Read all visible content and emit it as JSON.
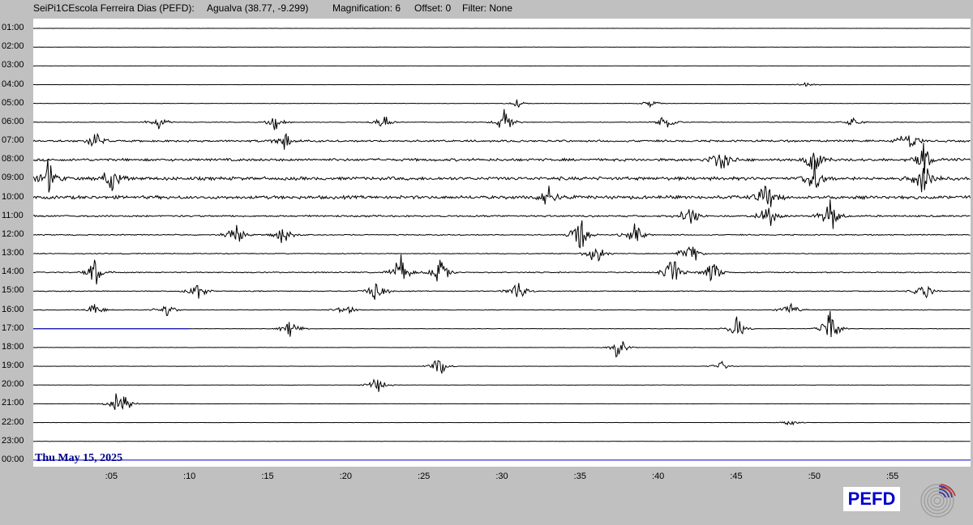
{
  "header": {
    "station": "SeiPi1CEscola Ferreira Dias (PEFD):",
    "location": "Agualva (38.77, -9.299)",
    "magnification": "Magnification: 6",
    "offset": "Offset: 0",
    "filter": "Filter: None"
  },
  "hours": [
    "01:00",
    "02:00",
    "03:00",
    "04:00",
    "05:00",
    "06:00",
    "07:00",
    "08:00",
    "09:00",
    "10:00",
    "11:00",
    "12:00",
    "13:00",
    "14:00",
    "15:00",
    "16:00",
    "17:00",
    "18:00",
    "19:00",
    "20:00",
    "21:00",
    "22:00",
    "23:00",
    "00:00"
  ],
  "minute_ticks": [
    ":05",
    ":10",
    ":15",
    ":20",
    ":25",
    ":30",
    ":35",
    ":40",
    ":45",
    ":50",
    ":55"
  ],
  "date_label": "Thu May 15, 2025",
  "logo": "PEFD",
  "colors": {
    "trace": "#000000",
    "current": "#0000cc",
    "date": "#00008b"
  },
  "current_trace": {
    "hour": "17:00",
    "minute": 10.0
  },
  "chart_data": {
    "type": "line",
    "title": "",
    "x_unit": "minutes past the hour",
    "xlim": [
      0,
      60
    ],
    "traces": [
      {
        "hour": "01:00",
        "activity": 0.05,
        "events": []
      },
      {
        "hour": "02:00",
        "activity": 0.05,
        "events": []
      },
      {
        "hour": "03:00",
        "activity": 0.05,
        "events": []
      },
      {
        "hour": "04:00",
        "activity": 0.05,
        "events": [
          {
            "minute": 49.5,
            "amp": 2
          }
        ]
      },
      {
        "hour": "05:00",
        "activity": 0.08,
        "events": [
          {
            "minute": 31,
            "amp": 2
          },
          {
            "minute": 39.5,
            "amp": 2
          }
        ]
      },
      {
        "hour": "06:00",
        "activity": 0.15,
        "events": [
          {
            "minute": 8,
            "amp": 5
          },
          {
            "minute": 15.5,
            "amp": 4
          },
          {
            "minute": 22.5,
            "amp": 5
          },
          {
            "minute": 30.2,
            "amp": 7
          },
          {
            "minute": 40.5,
            "amp": 5
          },
          {
            "minute": 52.5,
            "amp": 3
          }
        ]
      },
      {
        "hour": "07:00",
        "activity": 0.45,
        "events": [
          {
            "minute": 4,
            "amp": 5
          },
          {
            "minute": 16,
            "amp": 6
          },
          {
            "minute": 56,
            "amp": 8
          }
        ]
      },
      {
        "hour": "08:00",
        "activity": 0.6,
        "events": [
          {
            "minute": 44,
            "amp": 8
          },
          {
            "minute": 50,
            "amp": 9
          },
          {
            "minute": 57,
            "amp": 8
          }
        ]
      },
      {
        "hour": "09:00",
        "activity": 0.75,
        "events": [
          {
            "minute": 1,
            "amp": 10
          },
          {
            "minute": 5,
            "amp": 9
          },
          {
            "minute": 50,
            "amp": 10
          },
          {
            "minute": 57,
            "amp": 10
          }
        ]
      },
      {
        "hour": "10:00",
        "activity": 0.75,
        "events": [
          {
            "minute": 33,
            "amp": 8
          },
          {
            "minute": 47,
            "amp": 10
          }
        ]
      },
      {
        "hour": "11:00",
        "activity": 0.4,
        "events": [
          {
            "minute": 42,
            "amp": 7
          },
          {
            "minute": 47,
            "amp": 8
          },
          {
            "minute": 51,
            "amp": 11
          }
        ]
      },
      {
        "hour": "12:00",
        "activity": 0.25,
        "events": [
          {
            "minute": 13,
            "amp": 7
          },
          {
            "minute": 16,
            "amp": 6
          },
          {
            "minute": 35,
            "amp": 12
          },
          {
            "minute": 38.5,
            "amp": 7
          }
        ]
      },
      {
        "hour": "13:00",
        "activity": 0.2,
        "events": [
          {
            "minute": 36,
            "amp": 8
          },
          {
            "minute": 42,
            "amp": 9
          }
        ]
      },
      {
        "hour": "14:00",
        "activity": 0.25,
        "events": [
          {
            "minute": 4,
            "amp": 8
          },
          {
            "minute": 23.5,
            "amp": 9
          },
          {
            "minute": 26,
            "amp": 9
          },
          {
            "minute": 41,
            "amp": 11
          },
          {
            "minute": 43.5,
            "amp": 9
          }
        ]
      },
      {
        "hour": "15:00",
        "activity": 0.2,
        "events": [
          {
            "minute": 10.5,
            "amp": 6
          },
          {
            "minute": 22,
            "amp": 8
          },
          {
            "minute": 31,
            "amp": 7
          },
          {
            "minute": 57,
            "amp": 6
          }
        ]
      },
      {
        "hour": "16:00",
        "activity": 0.15,
        "events": [
          {
            "minute": 4,
            "amp": 4
          },
          {
            "minute": 8.5,
            "amp": 5
          },
          {
            "minute": 20,
            "amp": 4
          },
          {
            "minute": 48.5,
            "amp": 5
          }
        ]
      },
      {
        "hour": "17:00",
        "activity": 0.1,
        "events": [
          {
            "minute": 16.5,
            "amp": 6
          },
          {
            "minute": 45,
            "amp": 7
          },
          {
            "minute": 51,
            "amp": 11
          }
        ]
      },
      {
        "hour": "18:00",
        "activity": 0.08,
        "events": [
          {
            "minute": 37.5,
            "amp": 7
          }
        ]
      },
      {
        "hour": "19:00",
        "activity": 0.07,
        "events": [
          {
            "minute": 26,
            "amp": 6
          },
          {
            "minute": 44,
            "amp": 3
          }
        ]
      },
      {
        "hour": "20:00",
        "activity": 0.07,
        "events": [
          {
            "minute": 22,
            "amp": 5
          }
        ]
      },
      {
        "hour": "21:00",
        "activity": 0.06,
        "events": [
          {
            "minute": 5.3,
            "amp": 5
          },
          {
            "minute": 5.8,
            "amp": 5
          }
        ]
      },
      {
        "hour": "22:00",
        "activity": 0.05,
        "events": [
          {
            "minute": 48.5,
            "amp": 2
          }
        ]
      },
      {
        "hour": "23:00",
        "activity": 0.05,
        "events": []
      },
      {
        "hour": "00:00",
        "activity": 0.0,
        "events": []
      }
    ]
  }
}
